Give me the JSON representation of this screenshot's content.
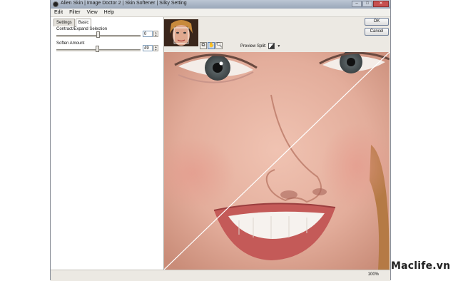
{
  "window": {
    "title": "Alien Skin | Image Doctor 2 | Skin Softener | Silky Setting"
  },
  "menu": [
    "Edit",
    "Filter",
    "View",
    "Help"
  ],
  "tabs": [
    {
      "label": "Settings",
      "active": false
    },
    {
      "label": "Basic",
      "active": true
    }
  ],
  "controls": {
    "contract": {
      "label": "Contract/Expand Selection",
      "value": "0",
      "slider_fraction": 0.5
    },
    "soften": {
      "label": "Soften Amount",
      "value": "49",
      "slider_fraction": 0.49
    }
  },
  "buttons": {
    "ok": "OK",
    "cancel": "Cancel"
  },
  "preview": {
    "split_label": "Preview Split:"
  },
  "status": {
    "zoom": "100%"
  },
  "watermark": "Maclife.vn",
  "colors": {
    "skin": "#e4b09e",
    "selection_accent": "#316ac5"
  }
}
